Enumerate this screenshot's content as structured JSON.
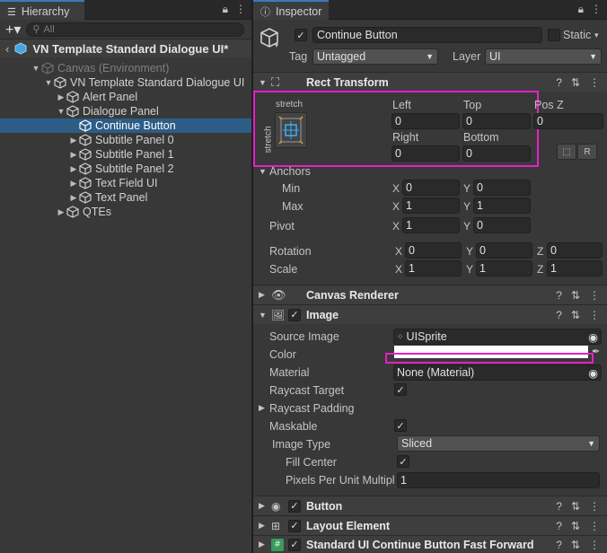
{
  "hierarchy": {
    "tab_label": "Hierarchy",
    "search_placeholder": "All",
    "scene_name": "VN Template Standard Dialogue UI*",
    "tree": [
      {
        "label": "Canvas (Environment)",
        "indent": 0,
        "arrow": "▼",
        "dim": true,
        "sel": false
      },
      {
        "label": "VN Template Standard Dialogue UI",
        "indent": 1,
        "arrow": "▼",
        "dim": false,
        "sel": false
      },
      {
        "label": "Alert Panel",
        "indent": 2,
        "arrow": "▶",
        "dim": false,
        "sel": false
      },
      {
        "label": "Dialogue Panel",
        "indent": 2,
        "arrow": "▼",
        "dim": false,
        "sel": false
      },
      {
        "label": "Continue Button",
        "indent": 3,
        "arrow": "",
        "dim": false,
        "sel": true
      },
      {
        "label": "Subtitle Panel 0",
        "indent": 3,
        "arrow": "▶",
        "dim": false,
        "sel": false
      },
      {
        "label": "Subtitle Panel 1",
        "indent": 3,
        "arrow": "▶",
        "dim": false,
        "sel": false
      },
      {
        "label": "Subtitle Panel 2",
        "indent": 3,
        "arrow": "▶",
        "dim": false,
        "sel": false
      },
      {
        "label": "Text Field UI",
        "indent": 3,
        "arrow": "▶",
        "dim": false,
        "sel": false
      },
      {
        "label": "Text Panel",
        "indent": 3,
        "arrow": "▶",
        "dim": false,
        "sel": false
      },
      {
        "label": "QTEs",
        "indent": 2,
        "arrow": "▶",
        "dim": false,
        "sel": false
      }
    ]
  },
  "inspector": {
    "tab_label": "Inspector",
    "object_name": "Continue Button",
    "static_label": "Static",
    "tag_label": "Tag",
    "tag_value": "Untagged",
    "layer_label": "Layer",
    "layer_value": "UI",
    "rect_transform": {
      "title": "Rect Transform",
      "anchor_preset": "stretch",
      "left_label": "Left",
      "left_value": "0",
      "top_label": "Top",
      "top_value": "0",
      "posz_label": "Pos Z",
      "posz_value": "0",
      "right_label": "Right",
      "right_value": "0",
      "bottom_label": "Bottom",
      "bottom_value": "0",
      "anchors_label": "Anchors",
      "min_label": "Min",
      "min_x": "0",
      "min_y": "0",
      "max_label": "Max",
      "max_x": "1",
      "max_y": "1",
      "pivot_label": "Pivot",
      "pivot_x": "1",
      "pivot_y": "0",
      "rotation_label": "Rotation",
      "rot_x": "0",
      "rot_y": "0",
      "rot_z": "0",
      "scale_label": "Scale",
      "scale_x": "1",
      "scale_y": "1",
      "scale_z": "1",
      "raw_btn": "R"
    },
    "canvas_renderer": {
      "title": "Canvas Renderer"
    },
    "image": {
      "title": "Image",
      "source_image_label": "Source Image",
      "source_image_value": "UISprite",
      "color_label": "Color",
      "color_value": "#ffffff",
      "material_label": "Material",
      "material_value": "None (Material)",
      "raycast_target_label": "Raycast Target",
      "raycast_padding_label": "Raycast Padding",
      "maskable_label": "Maskable",
      "image_type_label": "Image Type",
      "image_type_value": "Sliced",
      "fill_center_label": "Fill Center",
      "ppu_label": "Pixels Per Unit Multipl",
      "ppu_value": "1"
    },
    "button": {
      "title": "Button"
    },
    "layout_element": {
      "title": "Layout Element"
    },
    "script": {
      "title": "Standard UI Continue Button Fast Forward"
    }
  },
  "colors": {
    "accent": "#3a79bb",
    "selection": "#2c5d87",
    "highlight": "#e91ec8"
  },
  "labels": {
    "x": "X",
    "y": "Y",
    "z": "Z"
  }
}
